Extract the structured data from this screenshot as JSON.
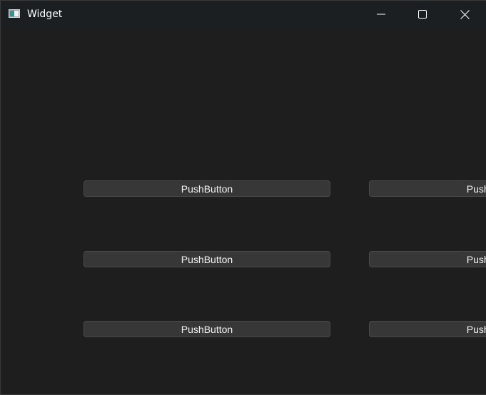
{
  "window": {
    "title": "Widget"
  },
  "icons": {
    "app": "window-app-icon",
    "minimize": "minimize-icon",
    "maximize": "maximize-icon",
    "close": "close-icon"
  },
  "colors": {
    "titlebar_bg": "#1b1f22",
    "client_bg": "#1e1e1e",
    "button_bg": "#373737",
    "button_border": "#4a4a4a",
    "text": "#f2f2f2"
  },
  "buttons": [
    {
      "label": "PushButton"
    },
    {
      "label": "PushButton"
    },
    {
      "label": "PushButton"
    },
    {
      "label": "PushButton"
    },
    {
      "label": "PushButton"
    },
    {
      "label": "PushButton"
    }
  ]
}
